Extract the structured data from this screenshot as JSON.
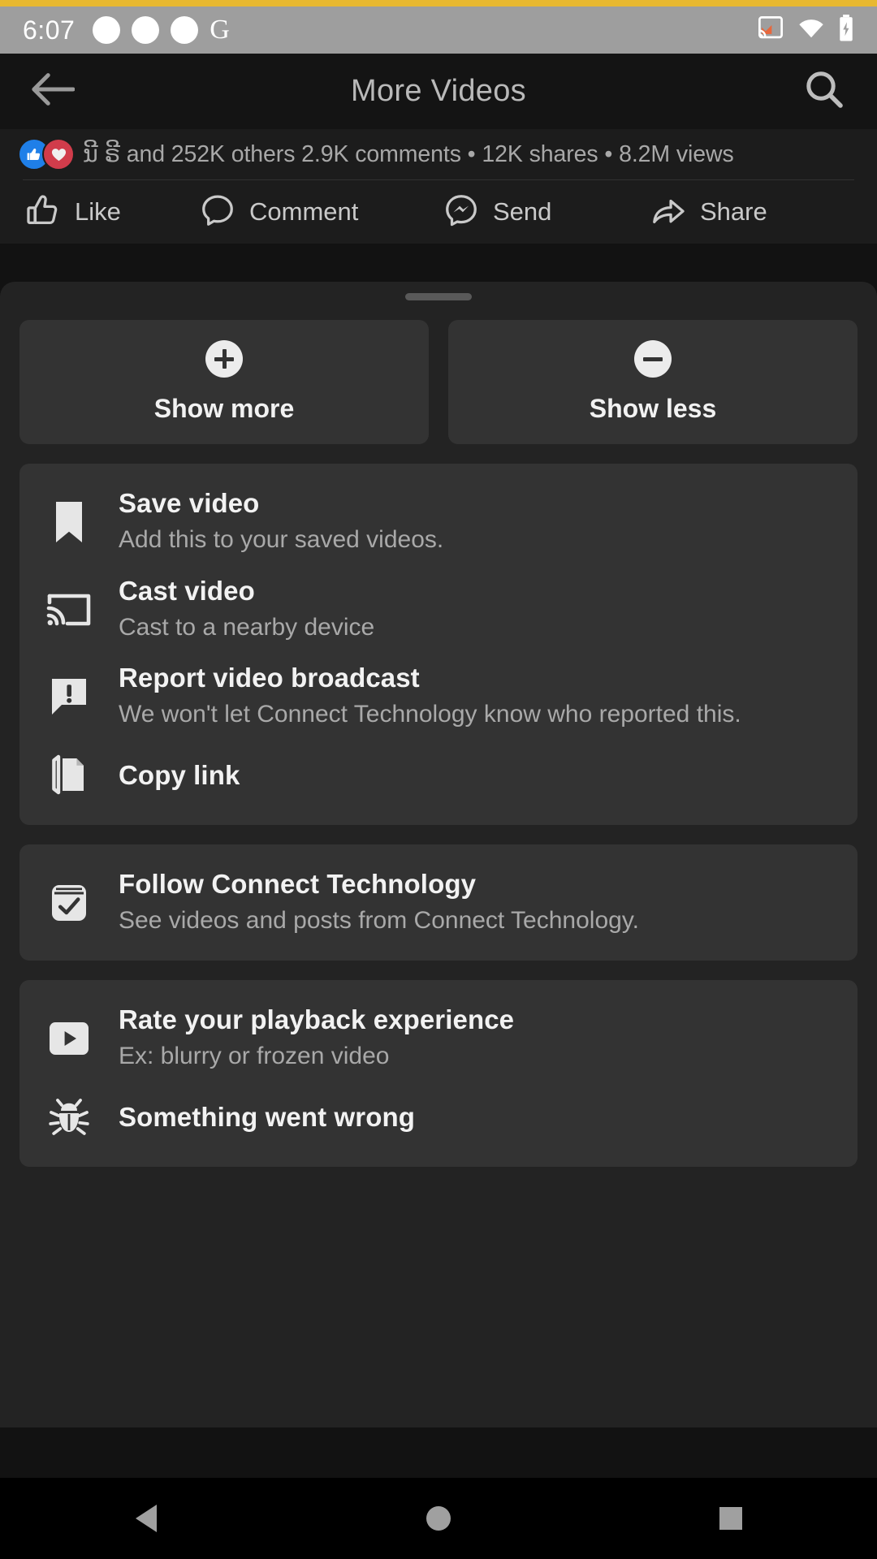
{
  "status_bar": {
    "time": "6:07",
    "left_icons": [
      "dot-icon",
      "dot-icon",
      "dot-icon",
      "google-g-icon"
    ],
    "right_icons": [
      "cast-active-icon",
      "wifi-icon",
      "battery-charging-icon"
    ],
    "background": "#9e9e9e"
  },
  "app_bar": {
    "back_icon": "arrow-left-icon",
    "title": "More Videos",
    "search_icon": "search-icon",
    "background": "#141414"
  },
  "post_stats": {
    "reactions": [
      "like-reaction-badge",
      "love-reaction-badge"
    ],
    "summary": "ນີ ຣີ and 252K others  2.9K comments • 12K shares • 8.2M views",
    "others_count": "252K",
    "comments": "2.9K comments",
    "shares": "12K shares",
    "views": "8.2M views"
  },
  "action_bar": {
    "actions": [
      {
        "label": "Like",
        "icon": "thumbs-up-icon"
      },
      {
        "label": "Comment",
        "icon": "comment-bubble-icon"
      },
      {
        "label": "Send",
        "icon": "messenger-send-icon"
      },
      {
        "label": "Share",
        "icon": "share-arrow-icon"
      }
    ]
  },
  "sheet": {
    "handle": "drag-handle",
    "toggles": [
      {
        "label": "Show more",
        "icon": "plus-circle-icon"
      },
      {
        "label": "Show less",
        "icon": "minus-circle-icon"
      }
    ],
    "groups": [
      {
        "items": [
          {
            "title": "Save video",
            "subtitle": "Add this to your saved videos.",
            "icon": "bookmark-icon"
          },
          {
            "title": "Cast video",
            "subtitle": "Cast to a nearby device",
            "icon": "cast-icon"
          },
          {
            "title": "Report video broadcast",
            "subtitle": "We won't let Connect Technology know who reported this.",
            "icon": "report-bubble-icon"
          },
          {
            "title": "Copy link",
            "subtitle": "",
            "icon": "copy-link-icon"
          }
        ]
      },
      {
        "items": [
          {
            "title": "Follow Connect Technology",
            "subtitle": "See videos and posts from Connect Technology.",
            "icon": "follow-check-icon"
          }
        ]
      },
      {
        "items": [
          {
            "title": "Rate your playback experience",
            "subtitle": "Ex: blurry or frozen video",
            "icon": "play-rectangle-icon"
          },
          {
            "title": "Something went wrong",
            "subtitle": "",
            "icon": "bug-icon"
          }
        ]
      }
    ]
  },
  "nav_bar": {
    "back": "nav-back-triangle-icon",
    "home": "nav-home-circle-icon",
    "recents": "nav-recents-square-icon"
  },
  "colors": {
    "accent_strip": "#e8b830",
    "sheet_bg": "#232323",
    "card_bg": "#333333",
    "like_blue": "#1f7fe8",
    "love_red": "#d13c4b",
    "cast_orange": "#e8673c"
  }
}
